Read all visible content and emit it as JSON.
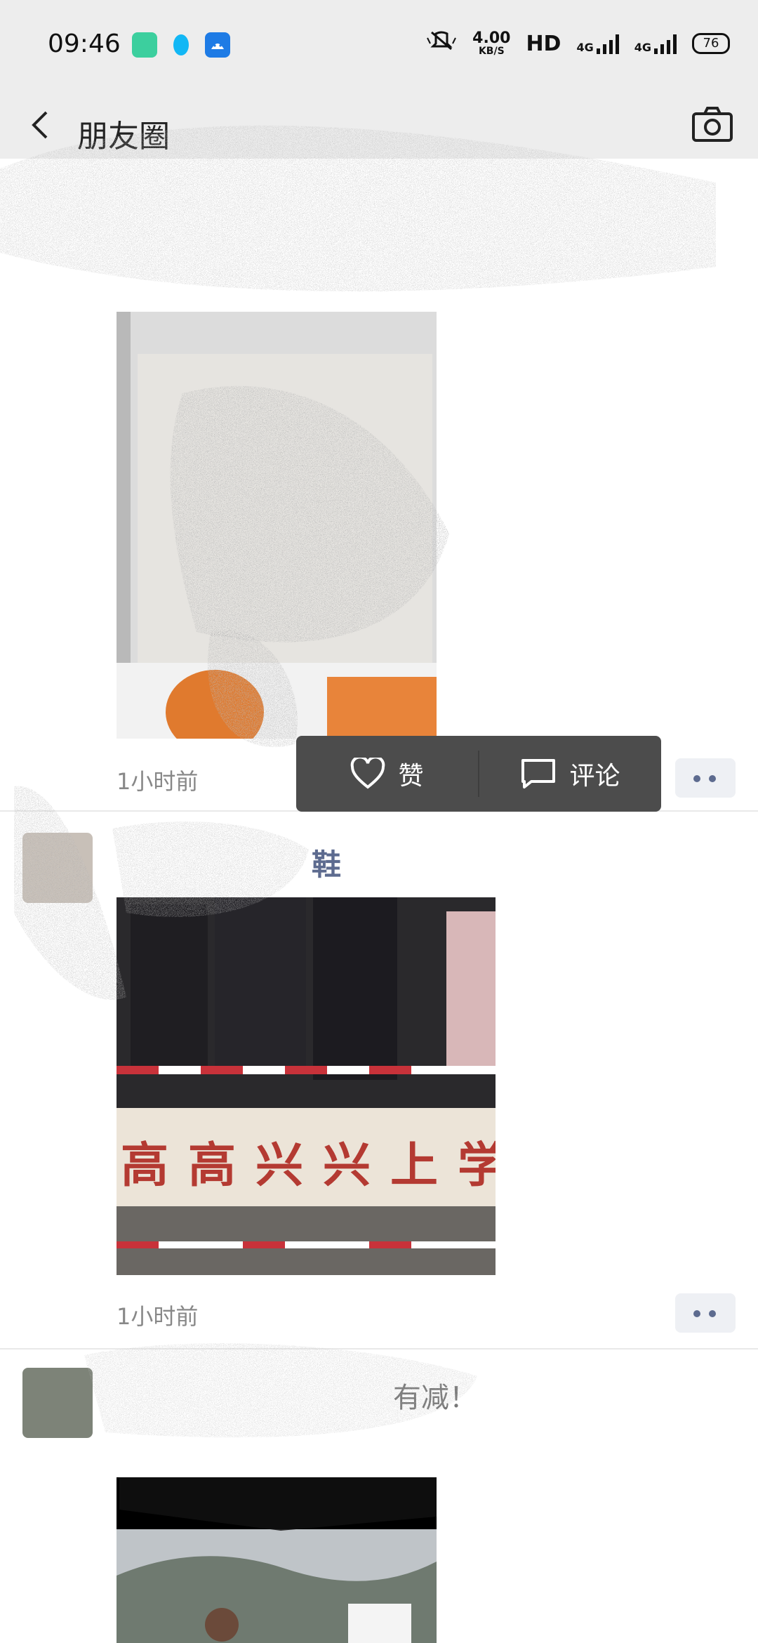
{
  "status_bar": {
    "time": "09:46",
    "net_speed_value": "4.00",
    "net_speed_unit": "KB/S",
    "hd_label": "HD",
    "network_1": "4G",
    "network_2": "4G",
    "battery": "76"
  },
  "nav": {
    "title": "朋友圈",
    "back_icon": "chevron-left-icon",
    "camera_icon": "camera-icon"
  },
  "posts": [
    {
      "time": "1小时前"
    },
    {
      "name": "鞋",
      "banner_text": "高高兴兴上学",
      "time": "1小时前"
    },
    {
      "text": "有减！"
    }
  ],
  "action_popup": {
    "like_label": "赞",
    "comment_label": "评论"
  },
  "colors": {
    "nav_bg": "#ededed",
    "name_color": "#5d6b8f",
    "popup_bg": "#4c4c4c",
    "status_icon_green": "#3ccf9e",
    "status_icon_qq": "#12b7f5",
    "status_icon_android": "#1e7be5"
  }
}
